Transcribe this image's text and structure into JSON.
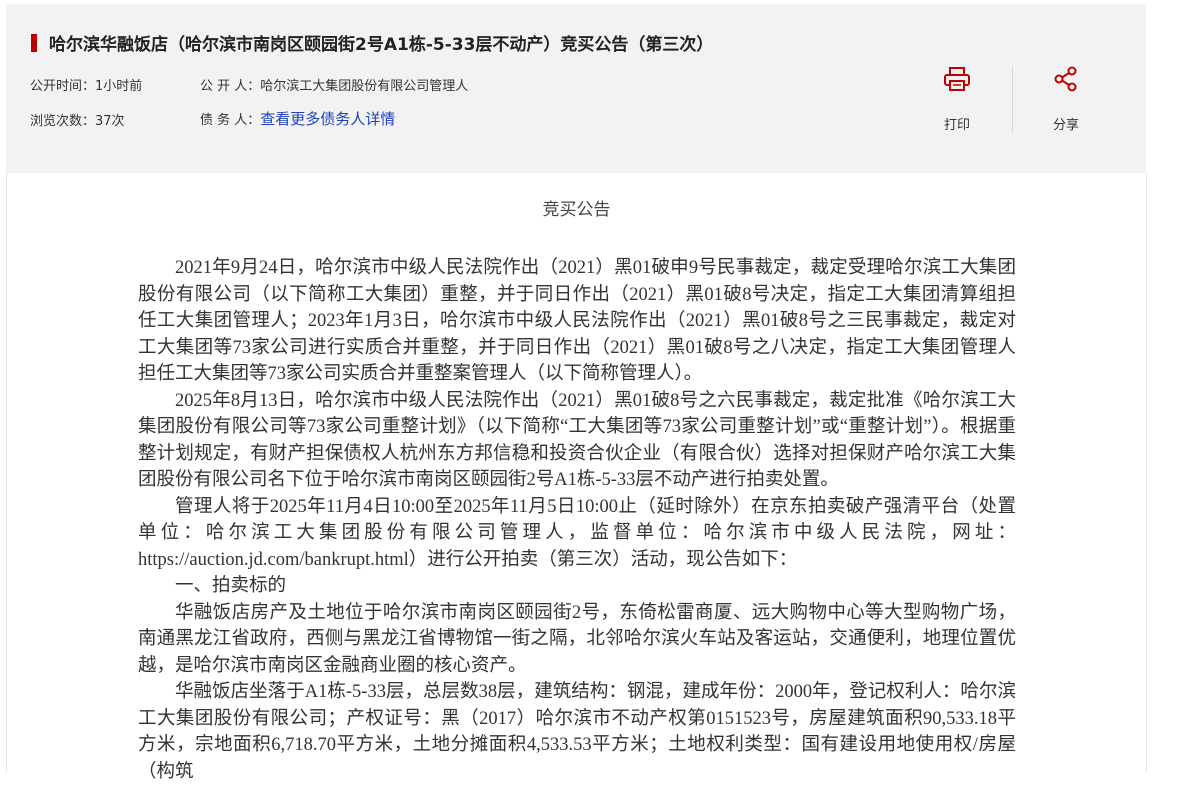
{
  "header": {
    "title": "哈尔滨华融饭店（哈尔滨市南岗区颐园街2号A1栋-5-33层不动产）竞买公告（第三次）",
    "publish_time_label": "公开时间：",
    "publish_time_value": "1小时前",
    "publisher_label": "公 开 人：",
    "publisher_value": "哈尔滨工大集团股份有限公司管理人",
    "views_label": "浏览次数：",
    "views_value": "37次",
    "debtor_label": "债 务 人：",
    "debtor_link": "查看更多债务人详情",
    "accent_color": "#c00000"
  },
  "actions": {
    "print_label": "打印",
    "share_label": "分享",
    "print_icon": "printer-icon",
    "share_icon": "share-icon"
  },
  "document": {
    "heading": "竞买公告",
    "paragraphs": [
      "2021年9月24日，哈尔滨市中级人民法院作出（2021）黑01破申9号民事裁定，裁定受理哈尔滨工大集团股份有限公司（以下简称工大集团）重整，并于同日作出（2021）黑01破8号决定，指定工大集团清算组担任工大集团管理人；2023年1月3日，哈尔滨市中级人民法院作出（2021）黑01破8号之三民事裁定，裁定对工大集团等73家公司进行实质合并重整，并于同日作出（2021）黑01破8号之八决定，指定工大集团管理人担任工大集团等73家公司实质合并重整案管理人（以下简称管理人）。",
      "2025年8月13日，哈尔滨市中级人民法院作出（2021）黑01破8号之六民事裁定，裁定批准《哈尔滨工大集团股份有限公司等73家公司重整计划》（以下简称“工大集团等73家公司重整计划”或“重整计划”）。根据重整计划规定，有财产担保债权人杭州东方邦信稳和投资合伙企业（有限合伙）选择对担保财产哈尔滨工大集团股份有限公司名下位于哈尔滨市南岗区颐园街2号A1栋-5-33层不动产进行拍卖处置。",
      "管理人将于2025年11月4日10:00至2025年11月5日10:00止（延时除外）在京东拍卖破产强清平台（处置单位：哈尔滨工大集团股份有限公司管理人，监督单位：哈尔滨市中级人民法院，网址：https://auction.jd.com/bankrupt.html）进行公开拍卖（第三次）活动，现公告如下：",
      "一、拍卖标的",
      "华融饭店房产及土地位于哈尔滨市南岗区颐园街2号，东倚松雷商厦、远大购物中心等大型购物广场，南通黑龙江省政府，西侧与黑龙江省博物馆一街之隔，北邻哈尔滨火车站及客运站，交通便利，地理位置优越，是哈尔滨市南岗区金融商业圈的核心资产。",
      "华融饭店坐落于A1栋-5-33层，总层数38层，建筑结构：钢混，建成年份：2000年，登记权利人：哈尔滨工大集团股份有限公司；产权证号：黑（2017）哈尔滨市不动产权第0151523号，房屋建筑面积90,533.18平方米，宗地面积6,718.70平方米，土地分摊面积4,533.53平方米；土地权利类型：国有建设用地使用权/房屋（构筑"
    ]
  }
}
